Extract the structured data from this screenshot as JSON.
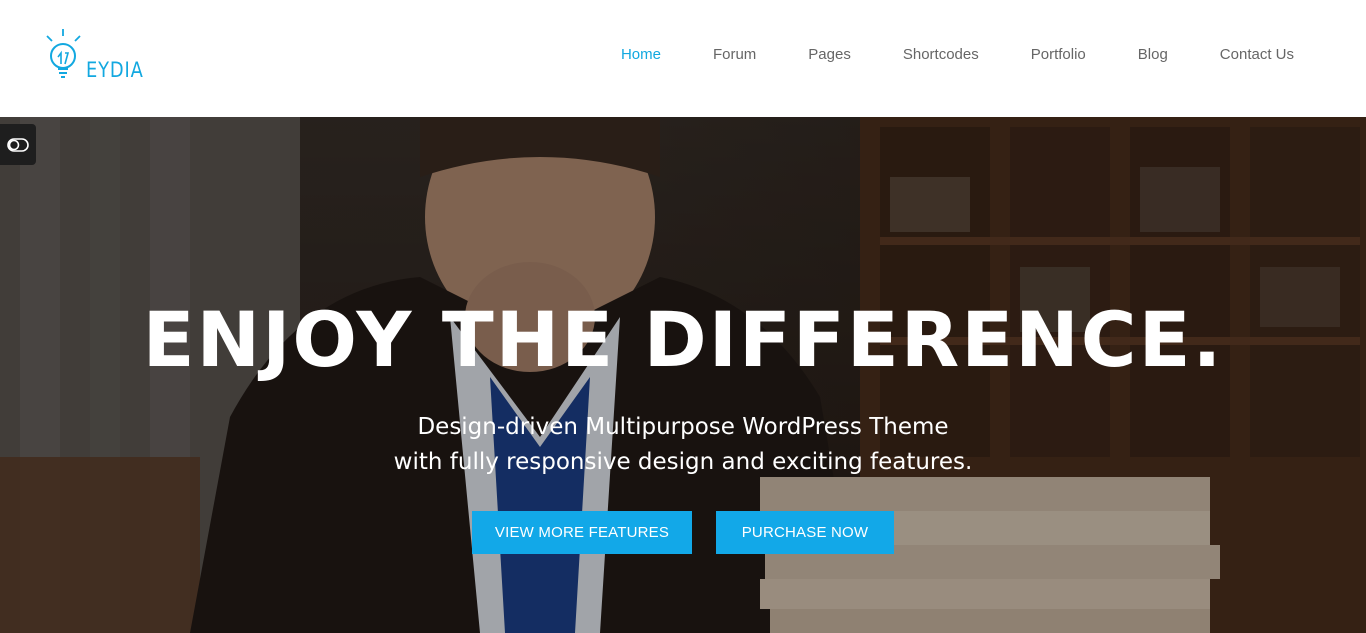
{
  "brand": {
    "logo_text": "EYDIA",
    "accent_color": "#12a8e0"
  },
  "nav": {
    "items": [
      {
        "label": "Home",
        "active": true
      },
      {
        "label": "Forum",
        "active": false
      },
      {
        "label": "Pages",
        "active": false
      },
      {
        "label": "Shortcodes",
        "active": false
      },
      {
        "label": "Portfolio",
        "active": false
      },
      {
        "label": "Blog",
        "active": false
      },
      {
        "label": "Contact Us",
        "active": false
      }
    ]
  },
  "side_toggle": {
    "icon": "toggle-icon"
  },
  "hero": {
    "title": "ENJOY THE DIFFERENCE.",
    "subtitle_line1": "Design-driven Multipurpose WordPress Theme",
    "subtitle_line2": "with fully responsive design and exciting features.",
    "buttons": {
      "features_label": "VIEW MORE FEATURES",
      "purchase_label": "PURCHASE NOW",
      "color": "#12a8e8"
    }
  }
}
